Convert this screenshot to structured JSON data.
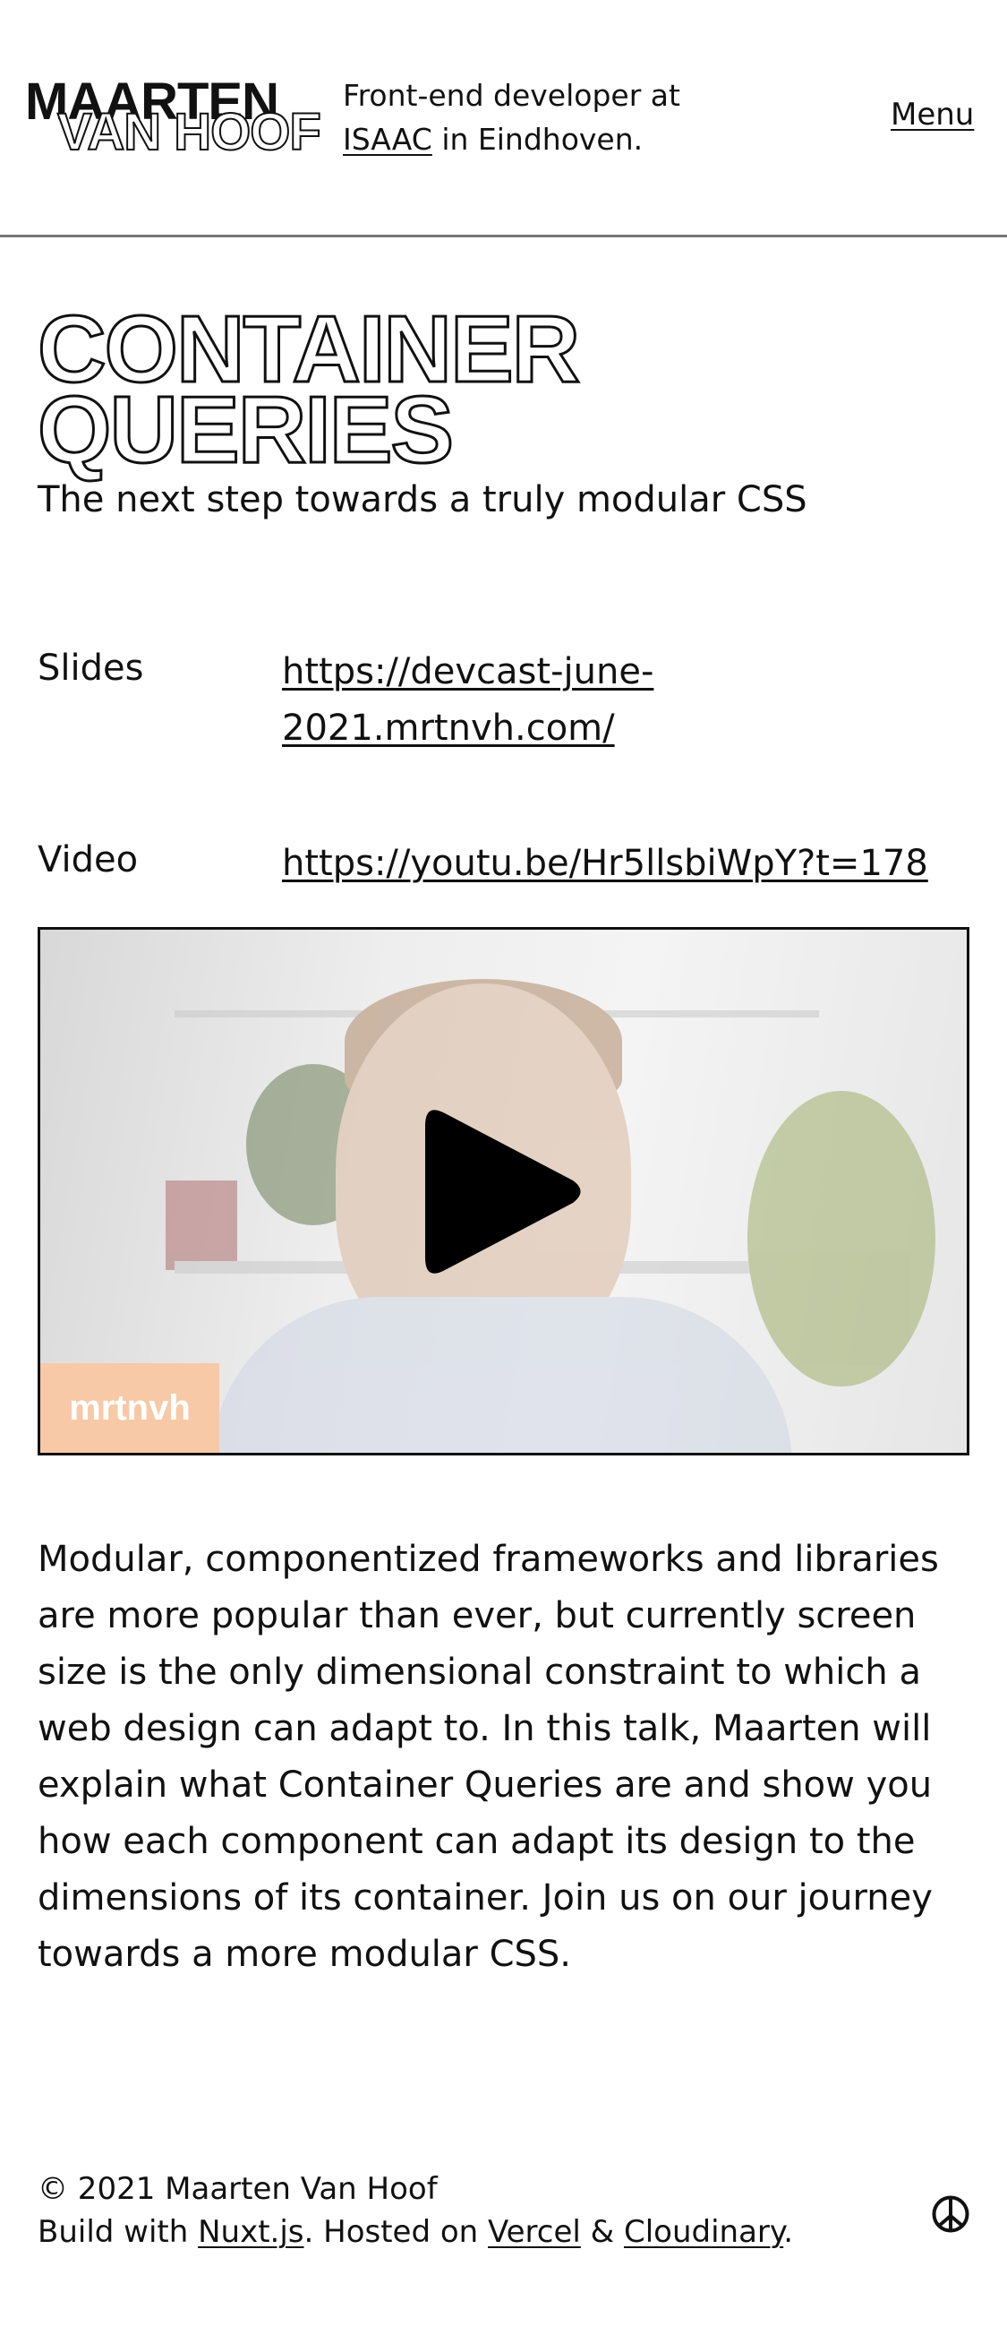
{
  "header": {
    "logo_line1": "MAARTEN",
    "logo_line2": "VAN HOOF",
    "intro_prefix": "Front-end developer at",
    "intro_company": "ISAAC",
    "intro_suffix": "in Eindhoven.",
    "menu_label": "Menu"
  },
  "talk": {
    "title_line1": "CONTAINER",
    "title_line2": "QUERIES",
    "subtitle": "The next step towards a truly modular CSS",
    "slides_label": "Slides",
    "slides_url": "https://devcast-june-2021.mrtnvh.com/",
    "video_label": "Video",
    "video_url": "https://youtu.be/Hr5llsbiWpY?t=178",
    "video_badge": "mrtnvh",
    "description": "Modular, componentized frameworks and libraries are more popular than ever, but currently screen size is the only dimensional constraint to which a web design can adapt to. In this talk, Maarten will explain what Container Queries are and show you how each component can adapt its design to the dimensions of its container. Join us on our journey towards a more modular CSS."
  },
  "footer": {
    "copyright": "© 2021 Maarten Van Hoof",
    "build_prefix": "Build with",
    "nuxt": "Nuxt.js",
    "hosted_prefix": ". Hosted on",
    "vercel": "Vercel",
    "amp": "&",
    "cloudinary": "Cloudinary",
    "end": ".",
    "icon": "peace-icon"
  }
}
